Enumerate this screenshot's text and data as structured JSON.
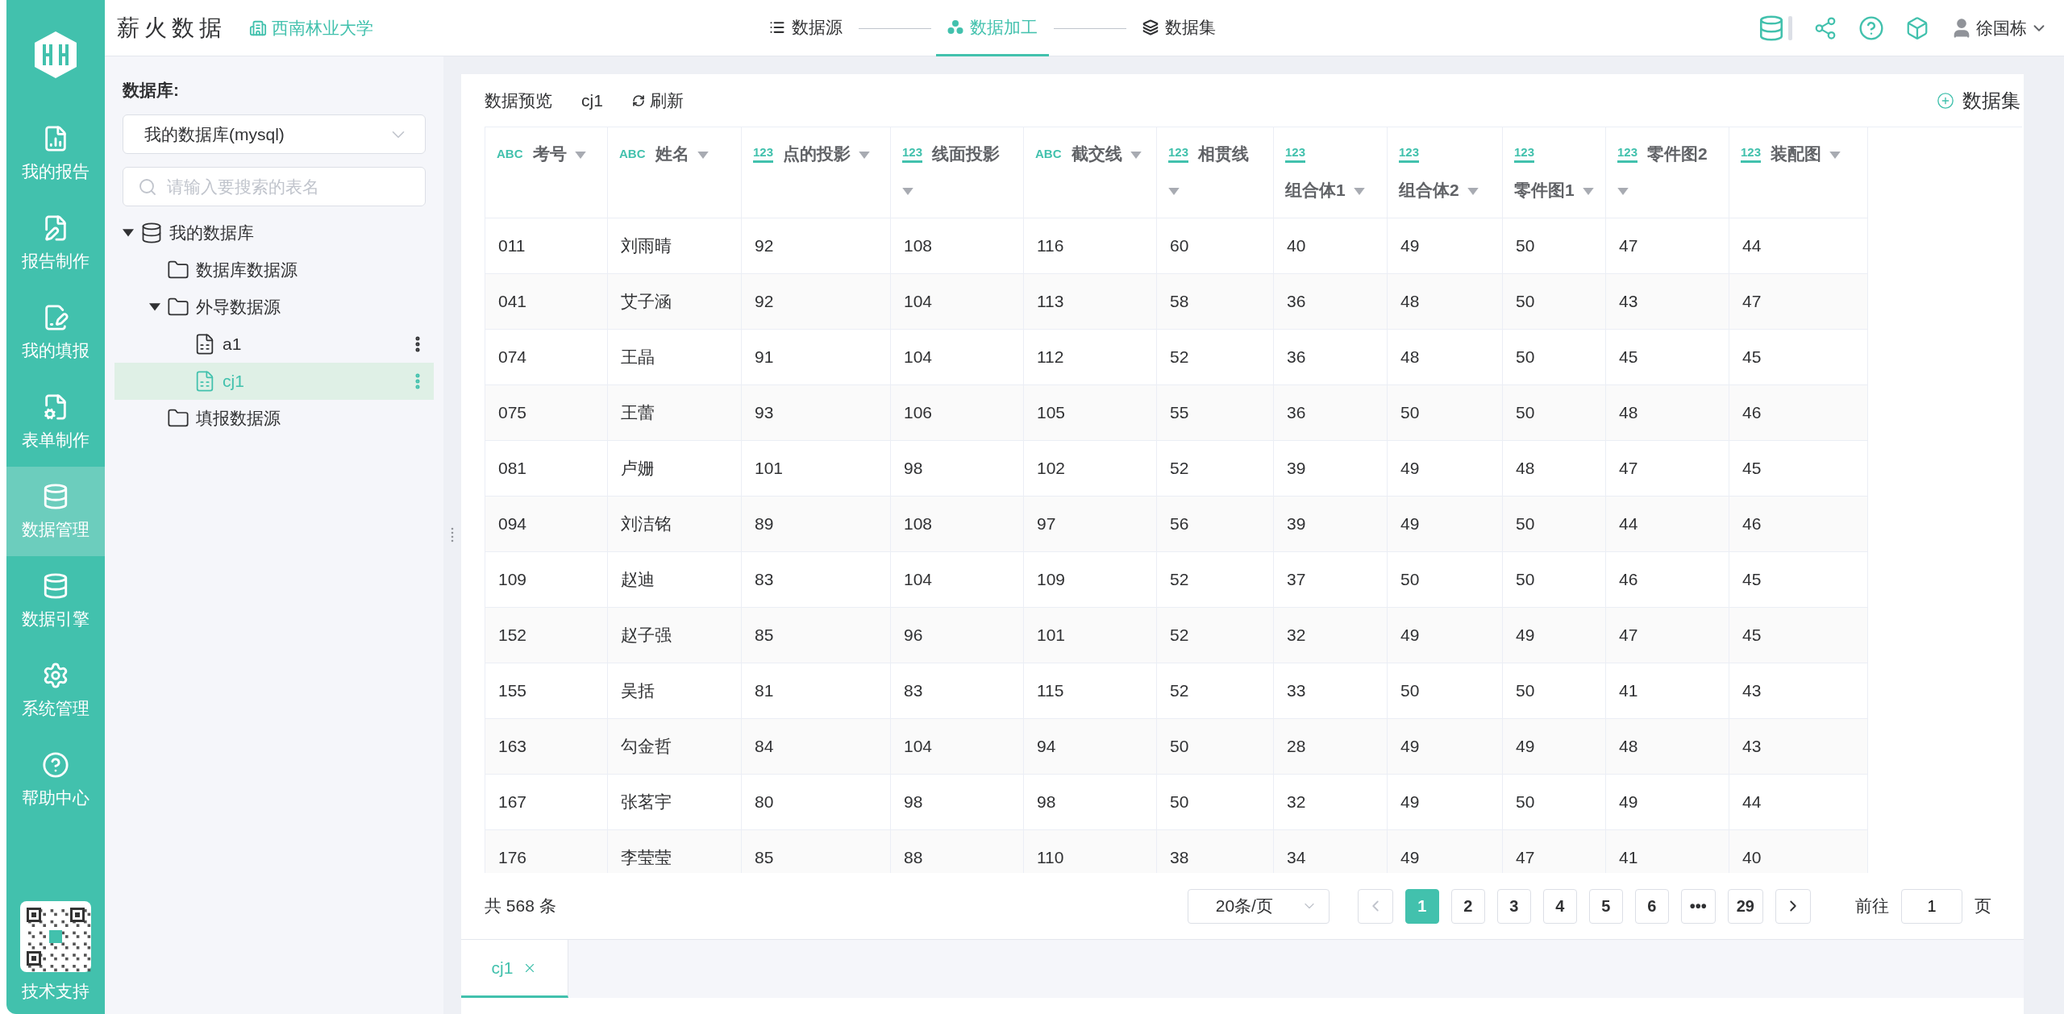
{
  "app": {
    "name": "薪火数据",
    "org": "西南林业大学"
  },
  "nav": [
    {
      "label": "我的报告",
      "selected": false
    },
    {
      "label": "报告制作",
      "selected": false
    },
    {
      "label": "我的填报",
      "selected": false
    },
    {
      "label": "表单制作",
      "selected": false
    },
    {
      "label": "数据管理",
      "selected": true
    },
    {
      "label": "数据引擎",
      "selected": false
    },
    {
      "label": "系统管理",
      "selected": false
    },
    {
      "label": "帮助中心",
      "selected": false
    }
  ],
  "support": {
    "label": "技术支持"
  },
  "steps": [
    {
      "label": "数据源",
      "selected": false
    },
    {
      "label": "数据加工",
      "selected": true
    },
    {
      "label": "数据集",
      "selected": false
    }
  ],
  "user": {
    "name": "徐国栋"
  },
  "database_panel": {
    "label": "数据库:",
    "select_value": "我的数据库(mysql)",
    "search_placeholder": "请输入要搜索的表名",
    "tree": [
      {
        "label": "我的数据库",
        "kind": "database",
        "expanded": true,
        "selected": false,
        "children": [
          {
            "label": "数据库数据源",
            "kind": "folder",
            "selected": false
          },
          {
            "label": "外导数据源",
            "kind": "folder",
            "expanded": true,
            "selected": false,
            "children": [
              {
                "label": "a1",
                "kind": "file",
                "selected": false
              },
              {
                "label": "cj1",
                "kind": "file",
                "selected": true
              }
            ]
          },
          {
            "label": "填报数据源",
            "kind": "folder",
            "selected": false
          }
        ]
      }
    ]
  },
  "preview": {
    "label": "数据预览",
    "table_name": "cj1",
    "refresh": "刷新",
    "add_dataset": "数据集"
  },
  "table": {
    "columns": [
      {
        "kind": "text",
        "type": "ABC",
        "name": "考号"
      },
      {
        "kind": "text",
        "type": "ABC",
        "name": "姓名"
      },
      {
        "kind": "number",
        "type": "123",
        "name": "点的投影"
      },
      {
        "kind": "number",
        "type": "123",
        "name": "线面投影"
      },
      {
        "kind": "text",
        "type": "ABC",
        "name": "截交线"
      },
      {
        "kind": "number",
        "type": "123",
        "name": "相贯线"
      },
      {
        "kind": "number",
        "type": "123",
        "name": "组合体1"
      },
      {
        "kind": "number",
        "type": "123",
        "name": "组合体2"
      },
      {
        "kind": "number",
        "type": "123",
        "name": "零件图1"
      },
      {
        "kind": "number",
        "type": "123",
        "name": "零件图2"
      },
      {
        "kind": "number",
        "type": "123",
        "name": "装配图"
      }
    ],
    "rows": [
      [
        "011",
        "刘雨晴",
        "92",
        "108",
        "116",
        "60",
        "40",
        "49",
        "50",
        "47",
        "44"
      ],
      [
        "041",
        "艾子涵",
        "92",
        "104",
        "113",
        "58",
        "36",
        "48",
        "50",
        "43",
        "47"
      ],
      [
        "074",
        "王晶",
        "91",
        "104",
        "112",
        "52",
        "36",
        "48",
        "50",
        "45",
        "45"
      ],
      [
        "075",
        "王蕾",
        "93",
        "106",
        "105",
        "55",
        "36",
        "50",
        "50",
        "48",
        "46"
      ],
      [
        "081",
        "卢姗",
        "101",
        "98",
        "102",
        "52",
        "39",
        "49",
        "48",
        "47",
        "45"
      ],
      [
        "094",
        "刘洁铭",
        "89",
        "108",
        "97",
        "56",
        "39",
        "49",
        "50",
        "44",
        "46"
      ],
      [
        "109",
        "赵迪",
        "83",
        "104",
        "109",
        "52",
        "37",
        "50",
        "50",
        "46",
        "45"
      ],
      [
        "152",
        "赵子强",
        "85",
        "96",
        "101",
        "52",
        "32",
        "49",
        "49",
        "47",
        "45"
      ],
      [
        "155",
        "吴括",
        "81",
        "83",
        "115",
        "52",
        "33",
        "50",
        "50",
        "41",
        "43"
      ],
      [
        "163",
        "勾金哲",
        "84",
        "104",
        "94",
        "50",
        "28",
        "49",
        "49",
        "48",
        "43"
      ],
      [
        "167",
        "张茗宇",
        "80",
        "98",
        "98",
        "50",
        "32",
        "49",
        "50",
        "49",
        "44"
      ],
      [
        "176",
        "李莹莹",
        "85",
        "88",
        "110",
        "38",
        "34",
        "49",
        "47",
        "41",
        "40"
      ]
    ]
  },
  "pagination": {
    "total": "共 568 条",
    "page_size": "20条/页",
    "pages": [
      {
        "label": "1",
        "selected": true
      },
      {
        "label": "2",
        "selected": false
      },
      {
        "label": "3",
        "selected": false
      },
      {
        "label": "4",
        "selected": false
      },
      {
        "label": "5",
        "selected": false
      },
      {
        "label": "6",
        "selected": false
      },
      {
        "label": "•••",
        "selected": false
      },
      {
        "label": "29",
        "selected": false
      }
    ],
    "goto_label": "前往",
    "goto_value": "1",
    "goto_suffix": "页"
  },
  "tabs": [
    {
      "label": "cj1",
      "selected": true
    }
  ]
}
